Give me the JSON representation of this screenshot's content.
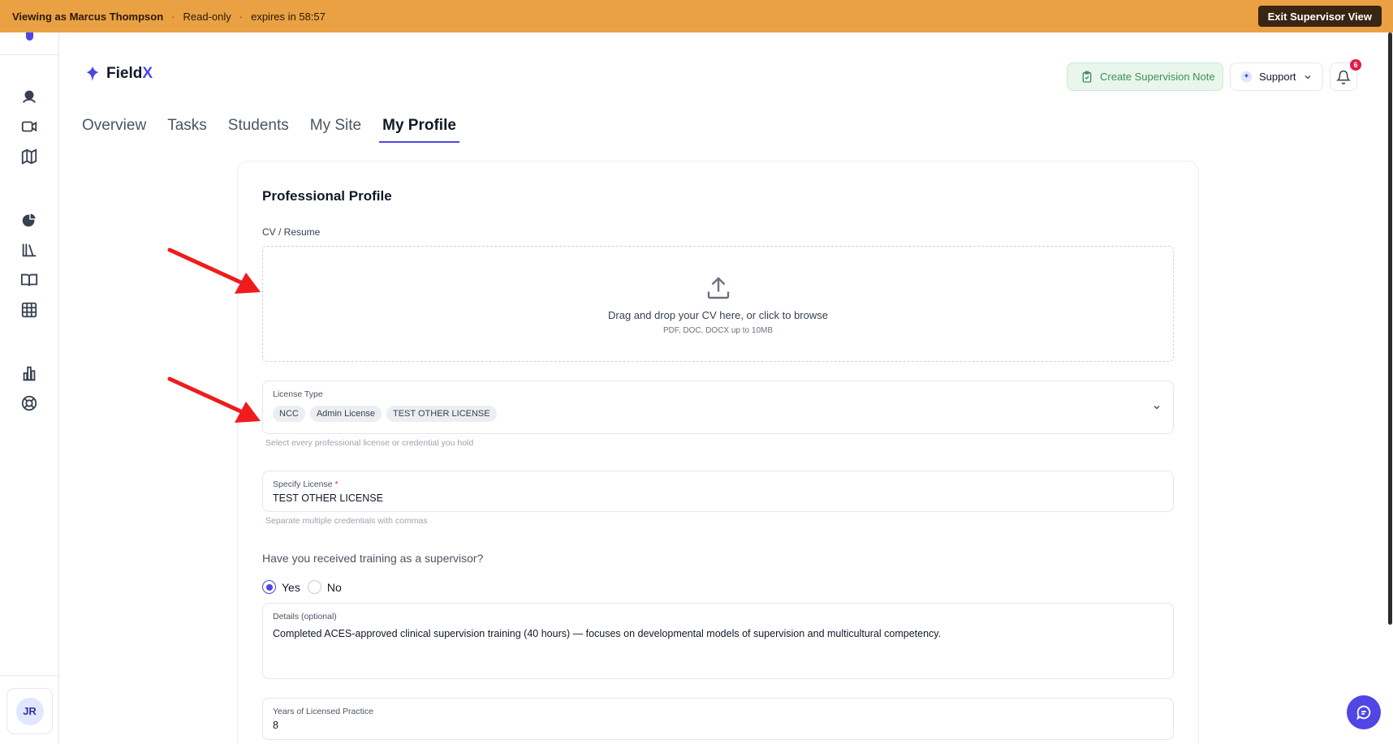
{
  "banner": {
    "viewing_as": "Viewing as Marcus Thompson",
    "mode": "Read-only",
    "expires": "expires in 58:57",
    "exit_label": "Exit Supervisor View"
  },
  "sidebar": {
    "items": [
      {
        "icon": "student-icon"
      },
      {
        "icon": "video-icon"
      },
      {
        "icon": "map-icon"
      },
      {
        "icon": "chart-pie-icon"
      },
      {
        "icon": "library-icon"
      },
      {
        "icon": "book-icon"
      },
      {
        "icon": "grid-icon"
      },
      {
        "icon": "bar-chart-icon"
      },
      {
        "icon": "lifebuoy-icon"
      }
    ],
    "user_initials": "JR"
  },
  "brand": {
    "name_prefix": "Field",
    "name_suffix": "X"
  },
  "header": {
    "create_note_label": "Create Supervision Note",
    "support_label": "Support",
    "notification_count": "6"
  },
  "tabs": [
    {
      "label": "Overview",
      "active": false
    },
    {
      "label": "Tasks",
      "active": false
    },
    {
      "label": "Students",
      "active": false
    },
    {
      "label": "My Site",
      "active": false
    },
    {
      "label": "My Profile",
      "active": true
    }
  ],
  "profile": {
    "title": "Professional Profile",
    "cv": {
      "label": "CV / Resume",
      "drop_text": "Drag and drop your CV here, or click to browse",
      "hint": "PDF, DOC, DOCX up to 10MB"
    },
    "license_type": {
      "label": "License Type",
      "chips": [
        "NCC",
        "Admin License",
        "TEST OTHER LICENSE"
      ],
      "help": "Select every professional license or credential you hold"
    },
    "specify_license": {
      "label": "Specify License",
      "required_mark": "*",
      "value": "TEST OTHER LICENSE",
      "help": "Separate multiple credentials with commas"
    },
    "training": {
      "question": "Have you received training as a supervisor?",
      "yes_label": "Yes",
      "no_label": "No",
      "selected": "Yes"
    },
    "details": {
      "label": "Details (optional)",
      "value": "Completed ACES-approved clinical supervision training (40 hours) — focuses on developmental models of supervision and multicultural competency."
    },
    "years": {
      "label": "Years of Licensed Practice",
      "value": "8"
    }
  },
  "colors": {
    "banner": "#e9a143",
    "accent": "#4f46e5",
    "annotation_arrow": "#ee1c1c",
    "note_button_bg": "#e8f6ec"
  }
}
